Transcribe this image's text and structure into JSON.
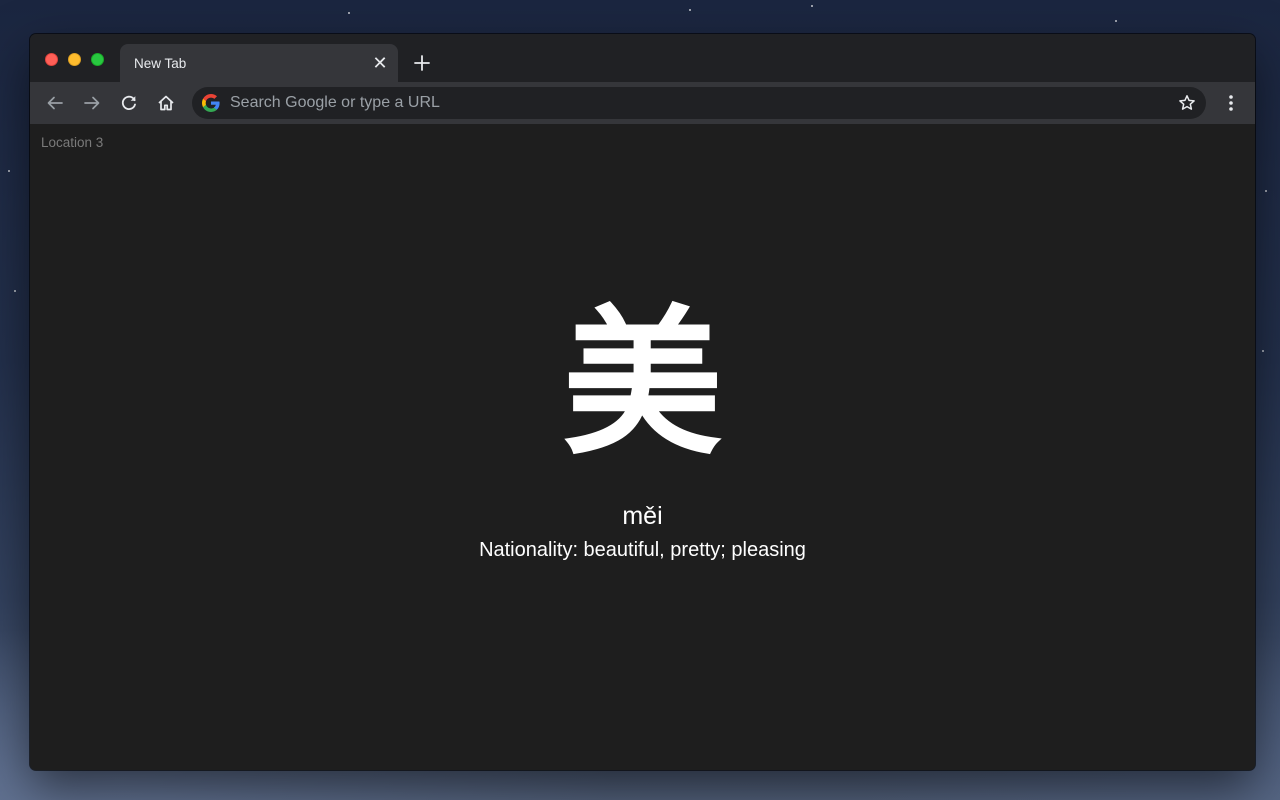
{
  "browser": {
    "tab": {
      "title": "New Tab",
      "close_glyph": "✕"
    },
    "new_tab_icon": "plus-icon",
    "toolbar": {
      "back_icon": "arrow-left-icon",
      "forward_icon": "arrow-right-icon",
      "reload_icon": "reload-icon",
      "home_icon": "home-icon",
      "omnibox": {
        "value": "",
        "placeholder": "Search Google or type a URL",
        "icon": "google-g-icon"
      },
      "bookmark_icon": "star-outline-icon",
      "menu_icon": "more-vertical-icon"
    },
    "window_controls": [
      "close",
      "minimize",
      "maximize"
    ]
  },
  "page": {
    "location_label": "Location 3",
    "character": "美",
    "pinyin": "měi",
    "meaning": "Nationality: beautiful, pretty; pleasing"
  },
  "colors": {
    "page_background": "#1e1e1e",
    "toolbar": "#35363a",
    "tabstrip": "#202124",
    "text_primary": "#ffffff",
    "text_muted": "#7a7a7a"
  }
}
